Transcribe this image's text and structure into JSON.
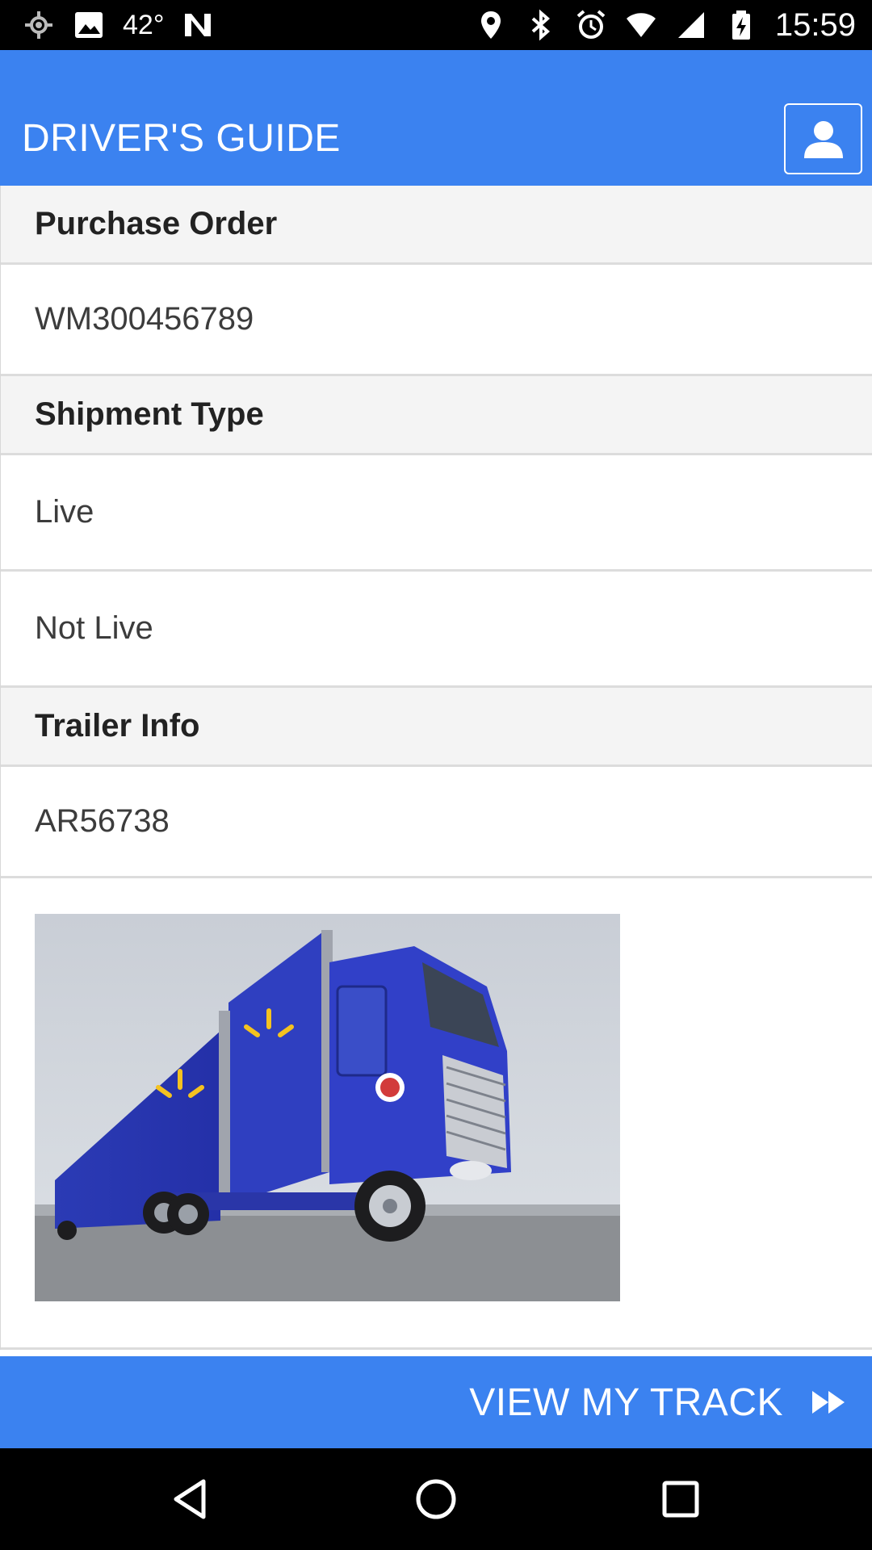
{
  "status_bar": {
    "temperature": "42°",
    "time": "15:59",
    "left_icons": [
      "location-target-icon",
      "image-icon",
      "n-app-icon"
    ],
    "right_icons": [
      "location-pin-icon",
      "bluetooth-icon",
      "alarm-icon",
      "wifi-icon",
      "signal-icon",
      "battery-charging-icon"
    ]
  },
  "app_bar": {
    "title": "DRIVER'S GUIDE",
    "profile_icon": "user-profile-icon"
  },
  "sections": {
    "purchase_order": {
      "header": "Purchase Order",
      "value": "WM300456789"
    },
    "shipment_type": {
      "header": "Shipment Type",
      "options": [
        "Live",
        "Not Live"
      ]
    },
    "trailer_info": {
      "header": "Trailer Info",
      "value": "AR56738"
    }
  },
  "cta": {
    "label": "VIEW MY TRACK",
    "icon": "fast-forward-icon"
  },
  "nav_bar": {
    "icons": [
      "back-icon",
      "home-icon",
      "recents-icon"
    ]
  },
  "colors": {
    "primary": "#3b82f0",
    "section_bg": "#f4f4f4",
    "divider": "#dcdcdc",
    "status_bar": "#000000"
  }
}
